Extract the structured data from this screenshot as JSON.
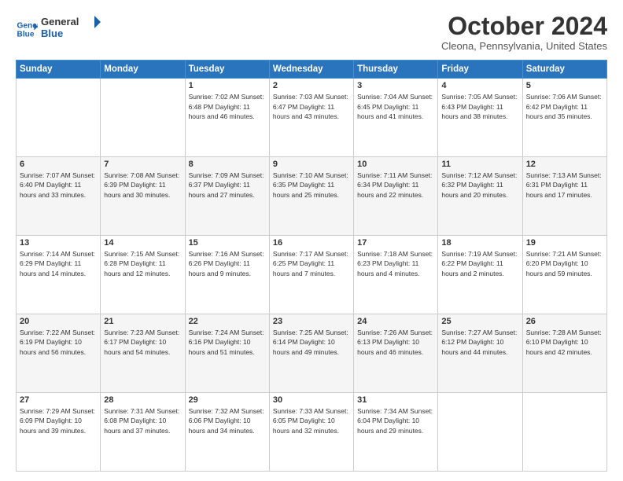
{
  "header": {
    "logo_line1": "General",
    "logo_line2": "Blue",
    "title": "October 2024",
    "subtitle": "Cleona, Pennsylvania, United States"
  },
  "days_of_week": [
    "Sunday",
    "Monday",
    "Tuesday",
    "Wednesday",
    "Thursday",
    "Friday",
    "Saturday"
  ],
  "weeks": [
    [
      {
        "day": "",
        "details": ""
      },
      {
        "day": "",
        "details": ""
      },
      {
        "day": "1",
        "details": "Sunrise: 7:02 AM\nSunset: 6:48 PM\nDaylight: 11 hours and 46 minutes."
      },
      {
        "day": "2",
        "details": "Sunrise: 7:03 AM\nSunset: 6:47 PM\nDaylight: 11 hours and 43 minutes."
      },
      {
        "day": "3",
        "details": "Sunrise: 7:04 AM\nSunset: 6:45 PM\nDaylight: 11 hours and 41 minutes."
      },
      {
        "day": "4",
        "details": "Sunrise: 7:05 AM\nSunset: 6:43 PM\nDaylight: 11 hours and 38 minutes."
      },
      {
        "day": "5",
        "details": "Sunrise: 7:06 AM\nSunset: 6:42 PM\nDaylight: 11 hours and 35 minutes."
      }
    ],
    [
      {
        "day": "6",
        "details": "Sunrise: 7:07 AM\nSunset: 6:40 PM\nDaylight: 11 hours and 33 minutes."
      },
      {
        "day": "7",
        "details": "Sunrise: 7:08 AM\nSunset: 6:39 PM\nDaylight: 11 hours and 30 minutes."
      },
      {
        "day": "8",
        "details": "Sunrise: 7:09 AM\nSunset: 6:37 PM\nDaylight: 11 hours and 27 minutes."
      },
      {
        "day": "9",
        "details": "Sunrise: 7:10 AM\nSunset: 6:35 PM\nDaylight: 11 hours and 25 minutes."
      },
      {
        "day": "10",
        "details": "Sunrise: 7:11 AM\nSunset: 6:34 PM\nDaylight: 11 hours and 22 minutes."
      },
      {
        "day": "11",
        "details": "Sunrise: 7:12 AM\nSunset: 6:32 PM\nDaylight: 11 hours and 20 minutes."
      },
      {
        "day": "12",
        "details": "Sunrise: 7:13 AM\nSunset: 6:31 PM\nDaylight: 11 hours and 17 minutes."
      }
    ],
    [
      {
        "day": "13",
        "details": "Sunrise: 7:14 AM\nSunset: 6:29 PM\nDaylight: 11 hours and 14 minutes."
      },
      {
        "day": "14",
        "details": "Sunrise: 7:15 AM\nSunset: 6:28 PM\nDaylight: 11 hours and 12 minutes."
      },
      {
        "day": "15",
        "details": "Sunrise: 7:16 AM\nSunset: 6:26 PM\nDaylight: 11 hours and 9 minutes."
      },
      {
        "day": "16",
        "details": "Sunrise: 7:17 AM\nSunset: 6:25 PM\nDaylight: 11 hours and 7 minutes."
      },
      {
        "day": "17",
        "details": "Sunrise: 7:18 AM\nSunset: 6:23 PM\nDaylight: 11 hours and 4 minutes."
      },
      {
        "day": "18",
        "details": "Sunrise: 7:19 AM\nSunset: 6:22 PM\nDaylight: 11 hours and 2 minutes."
      },
      {
        "day": "19",
        "details": "Sunrise: 7:21 AM\nSunset: 6:20 PM\nDaylight: 10 hours and 59 minutes."
      }
    ],
    [
      {
        "day": "20",
        "details": "Sunrise: 7:22 AM\nSunset: 6:19 PM\nDaylight: 10 hours and 56 minutes."
      },
      {
        "day": "21",
        "details": "Sunrise: 7:23 AM\nSunset: 6:17 PM\nDaylight: 10 hours and 54 minutes."
      },
      {
        "day": "22",
        "details": "Sunrise: 7:24 AM\nSunset: 6:16 PM\nDaylight: 10 hours and 51 minutes."
      },
      {
        "day": "23",
        "details": "Sunrise: 7:25 AM\nSunset: 6:14 PM\nDaylight: 10 hours and 49 minutes."
      },
      {
        "day": "24",
        "details": "Sunrise: 7:26 AM\nSunset: 6:13 PM\nDaylight: 10 hours and 46 minutes."
      },
      {
        "day": "25",
        "details": "Sunrise: 7:27 AM\nSunset: 6:12 PM\nDaylight: 10 hours and 44 minutes."
      },
      {
        "day": "26",
        "details": "Sunrise: 7:28 AM\nSunset: 6:10 PM\nDaylight: 10 hours and 42 minutes."
      }
    ],
    [
      {
        "day": "27",
        "details": "Sunrise: 7:29 AM\nSunset: 6:09 PM\nDaylight: 10 hours and 39 minutes."
      },
      {
        "day": "28",
        "details": "Sunrise: 7:31 AM\nSunset: 6:08 PM\nDaylight: 10 hours and 37 minutes."
      },
      {
        "day": "29",
        "details": "Sunrise: 7:32 AM\nSunset: 6:06 PM\nDaylight: 10 hours and 34 minutes."
      },
      {
        "day": "30",
        "details": "Sunrise: 7:33 AM\nSunset: 6:05 PM\nDaylight: 10 hours and 32 minutes."
      },
      {
        "day": "31",
        "details": "Sunrise: 7:34 AM\nSunset: 6:04 PM\nDaylight: 10 hours and 29 minutes."
      },
      {
        "day": "",
        "details": ""
      },
      {
        "day": "",
        "details": ""
      }
    ]
  ]
}
